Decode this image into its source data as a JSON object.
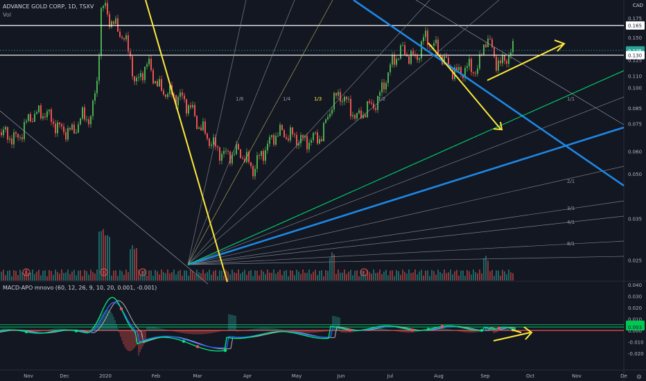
{
  "header": {
    "title": "ADVANCE GOLD CORP, 1D, TSXV",
    "volume_label": "Vol",
    "currency": "CAD"
  },
  "macd": {
    "title": "MACD-APO mnovo (60, 12, 26, 9, 10, 20, 0.001, -0.001)",
    "ticks": [
      "0.040",
      "0.030",
      "0.020",
      "0.010",
      "0.000",
      "-0.010",
      "-0.020"
    ],
    "tick_values": [
      0.04,
      0.03,
      0.02,
      0.01,
      0.0,
      -0.01,
      -0.02
    ],
    "badges": [
      {
        "value": "0.005",
        "color": "#00c853"
      },
      {
        "value": "0.003",
        "color": "#00c853"
      }
    ]
  },
  "price_axis": {
    "ticks": [
      "0.175",
      "0.150",
      "0.125",
      "0.110",
      "0.100",
      "0.085",
      "0.075",
      "0.060",
      "0.050",
      "0.035",
      "0.025"
    ],
    "tick_values": [
      0.175,
      0.15,
      0.125,
      0.11,
      0.1,
      0.085,
      0.075,
      0.06,
      0.05,
      0.035,
      0.025
    ],
    "badges": [
      {
        "value": "0.165",
        "color": "#ffffff"
      },
      {
        "value": "0.135",
        "color": "#26a69a"
      },
      {
        "value": "0.130",
        "color": "#ffffff"
      }
    ]
  },
  "time_axis": [
    "Nov",
    "Dec",
    "2020",
    "Feb",
    "Mar",
    "Apr",
    "May",
    "Jun",
    "Jul",
    "Aug",
    "Sep",
    "Oct",
    "Nov",
    "De"
  ],
  "fan_labels": {
    "upper": [
      "1/8",
      "1/4",
      "1/3",
      "1/2",
      "1/1"
    ],
    "lower": [
      "2/1",
      "3/1",
      "4/1",
      "8/1"
    ]
  },
  "events": [
    "E",
    "E",
    "E",
    "E"
  ],
  "colors": {
    "up": "#26a69a",
    "down": "#ef5350",
    "up_body": "#4caf50",
    "blue_line": "#1e88e5",
    "yellow": "#ffeb3b",
    "green_line": "#00e676"
  },
  "chart_data": {
    "type": "candlestick",
    "title": "ADVANCE GOLD CORP, 1D, TSXV",
    "ylim": [
      0.021,
      0.198
    ],
    "x_labels": [
      "Nov",
      "Dec",
      "2020",
      "Feb",
      "Mar",
      "Apr",
      "May",
      "Jun",
      "Jul",
      "Aug",
      "Sep",
      "Oct",
      "Nov",
      "De"
    ],
    "horizontal_levels": [
      0.165,
      0.13
    ],
    "last_close": 0.135,
    "approx_closes": [
      {
        "x": "Nov",
        "y": 0.082
      },
      {
        "x": "Dec",
        "y": 0.078
      },
      {
        "x": "2020",
        "y": 0.175
      },
      {
        "x": "Feb",
        "y": 0.105
      },
      {
        "x": "Mar",
        "y": 0.06
      },
      {
        "x": "Apr",
        "y": 0.065
      },
      {
        "x": "May",
        "y": 0.072
      },
      {
        "x": "Jun",
        "y": 0.1
      },
      {
        "x": "Jul",
        "y": 0.13
      },
      {
        "x": "Aug",
        "y": 0.12
      },
      {
        "x": "Sep",
        "y": 0.135
      }
    ]
  }
}
